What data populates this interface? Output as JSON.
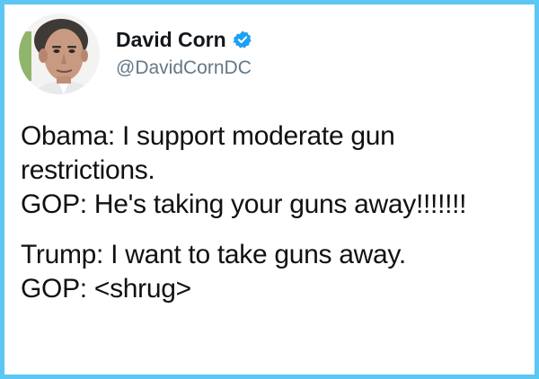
{
  "author": {
    "name": "David Corn",
    "handle": "@DavidCornDC",
    "verified": true
  },
  "colors": {
    "frame_border": "#5ec6f2",
    "verified_badge": "#1da1f2",
    "handle_text": "#657786",
    "body_text": "#111111"
  },
  "tweet": {
    "para1": {
      "line1": "Obama: I support moderate gun",
      "line2": "restrictions.",
      "line3": "GOP: He's taking your guns away!!!!!!!"
    },
    "para2": {
      "line1": "Trump: I want to take guns away.",
      "line2": "GOP: <shrug>"
    }
  },
  "icons": {
    "verified": "verified-badge-icon",
    "avatar": "profile-photo"
  }
}
